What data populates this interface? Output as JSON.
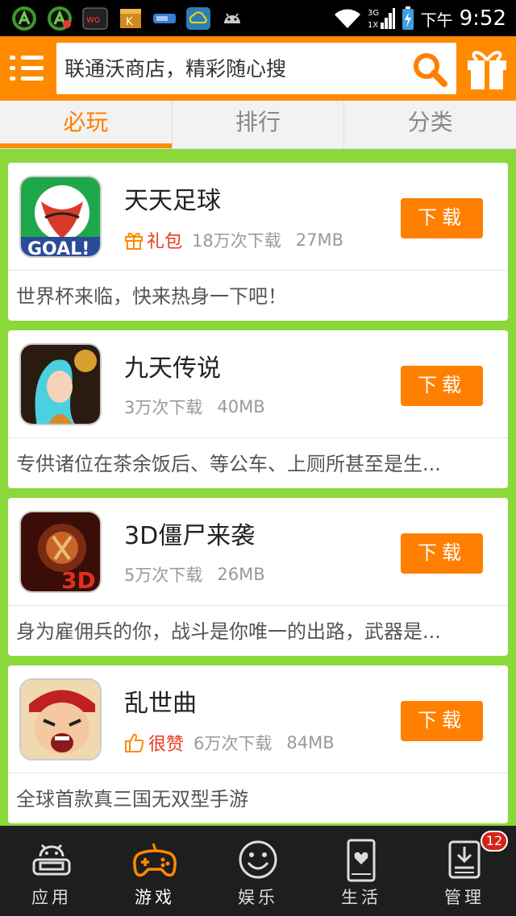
{
  "status_bar": {
    "ampm": "下午",
    "time": "9:52",
    "signal_label": "3G",
    "signal_label2": "1X",
    "notification_icons": [
      "green-a-icon",
      "green-a-icon",
      "wo-icon",
      "kingsoft-icon",
      "usb-icon",
      "cloud-icon",
      "android-icon"
    ]
  },
  "header": {
    "search_placeholder": "联通沃商店，精彩随心搜",
    "accent_color": "#ff8a00"
  },
  "tabs": [
    {
      "label": "必玩",
      "active": true
    },
    {
      "label": "排行",
      "active": false
    },
    {
      "label": "分类",
      "active": false
    }
  ],
  "apps": [
    {
      "name": "天天足球",
      "badge": "礼包",
      "badge_type": "gift",
      "downloads": "18万次下载",
      "size": "27MB",
      "button": "下载",
      "desc": "世界杯来临，快来热身一下吧！"
    },
    {
      "name": "九天传说",
      "badge": "",
      "badge_type": "",
      "downloads": "3万次下载",
      "size": "40MB",
      "button": "下载",
      "desc": "专供诸位在茶余饭后、等公车、上厕所甚至是生..."
    },
    {
      "name": "3D僵尸来袭",
      "badge": "",
      "badge_type": "",
      "downloads": "5万次下载",
      "size": "26MB",
      "button": "下载",
      "desc": "身为雇佣兵的你，战斗是你唯一的出路，武器是..."
    },
    {
      "name": "乱世曲",
      "badge": "很赞",
      "badge_type": "thumb",
      "downloads": "6万次下载",
      "size": "84MB",
      "button": "下载",
      "desc": "全球首款真三国无双型手游"
    }
  ],
  "bottom_nav": [
    {
      "label": "应用",
      "icon": "robot-sofa-icon",
      "active": false
    },
    {
      "label": "游戏",
      "icon": "gamepad-icon",
      "active": true
    },
    {
      "label": "娱乐",
      "icon": "smiley-icon",
      "active": false
    },
    {
      "label": "生活",
      "icon": "phone-heart-icon",
      "active": false
    },
    {
      "label": "管理",
      "icon": "download-manage-icon",
      "active": false,
      "badge": "12"
    }
  ]
}
